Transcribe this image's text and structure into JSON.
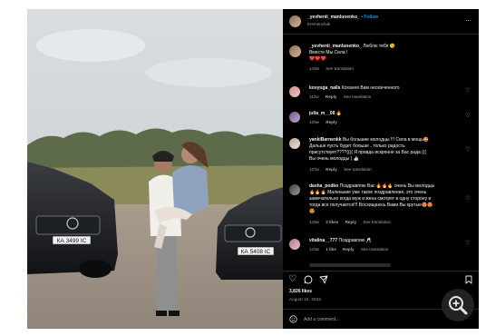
{
  "colors": {
    "panel_bg": "#000000",
    "link_blue": "#0095f6",
    "muted": "#a8a8a8"
  },
  "photo": {
    "next_icon": "chevron-right-icon",
    "car_left_plate": "КА 3499 ІС",
    "car_right_plate": "КА 5408 ІС"
  },
  "header": {
    "username": "_yevhenii_manlunenko_",
    "separator": "•",
    "follow_label": "Follow",
    "location": "Kremenchuk",
    "more_icon": "more-horizontal-icon"
  },
  "caption": {
    "username": "_yevhenii_manlunenko_",
    "text_line1": "Люблю тебя 😘",
    "text_line2": "Вместе Мы Сила !",
    "text_line3": "❤️❤️❤️",
    "time": "143w",
    "see_translation": "See translation"
  },
  "comments": [
    {
      "username": "kosyuga_nails",
      "text": "Кохання Вам нескінченного",
      "time": "112w",
      "reply": "Reply",
      "see_translation": "See translation"
    },
    {
      "username": "julia_m__08",
      "text": "🔥",
      "time": "129w",
      "reply": "Reply"
    },
    {
      "username": "yankiBarnenkk",
      "text_lines": [
        "Вы большие молодцы !!! Сила в мощь🤩",
        "Дальше пусть будет больше , только радость",
        "присутствует????(((( Я правда искренне за Вас рада (((",
        "Вы очень молодцы ) 👍🏻"
      ],
      "time": "127w",
      "reply": "Reply",
      "see_translation": "See translation"
    },
    {
      "username": "dasha_podko",
      "text_lines": [
        "Поздравляю Вас 🔥🔥🔥 очень Вы молодцы",
        "🔥🔥🔥 Маленькие уже такое поздравление, это очень",
        "замечательно когда муж и жена смотрят в одну сторону и",
        "тогда все получается!!! Восхищаюсь Вами Вы крутые😍😍",
        "😍"
      ],
      "time": "143w",
      "likes": "2 likes",
      "reply": "Reply",
      "see_translation": "See translation"
    },
    {
      "username": "vitalina__777",
      "text": "Поздравляю 🥂",
      "time": "143w",
      "likes": "1 like",
      "reply": "Reply",
      "see_translation": "See translation"
    }
  ],
  "actions": {
    "like_icon": "heart-icon",
    "comment_icon": "comment-icon",
    "share_icon": "share-icon",
    "save_icon": "bookmark-icon"
  },
  "likes": "3,826 likes",
  "date": "August 16, 2022",
  "add_comment": {
    "placeholder": "Add a comment…",
    "emoji_icon": "smiley-icon"
  },
  "zoom_icon": "zoom-in-icon"
}
